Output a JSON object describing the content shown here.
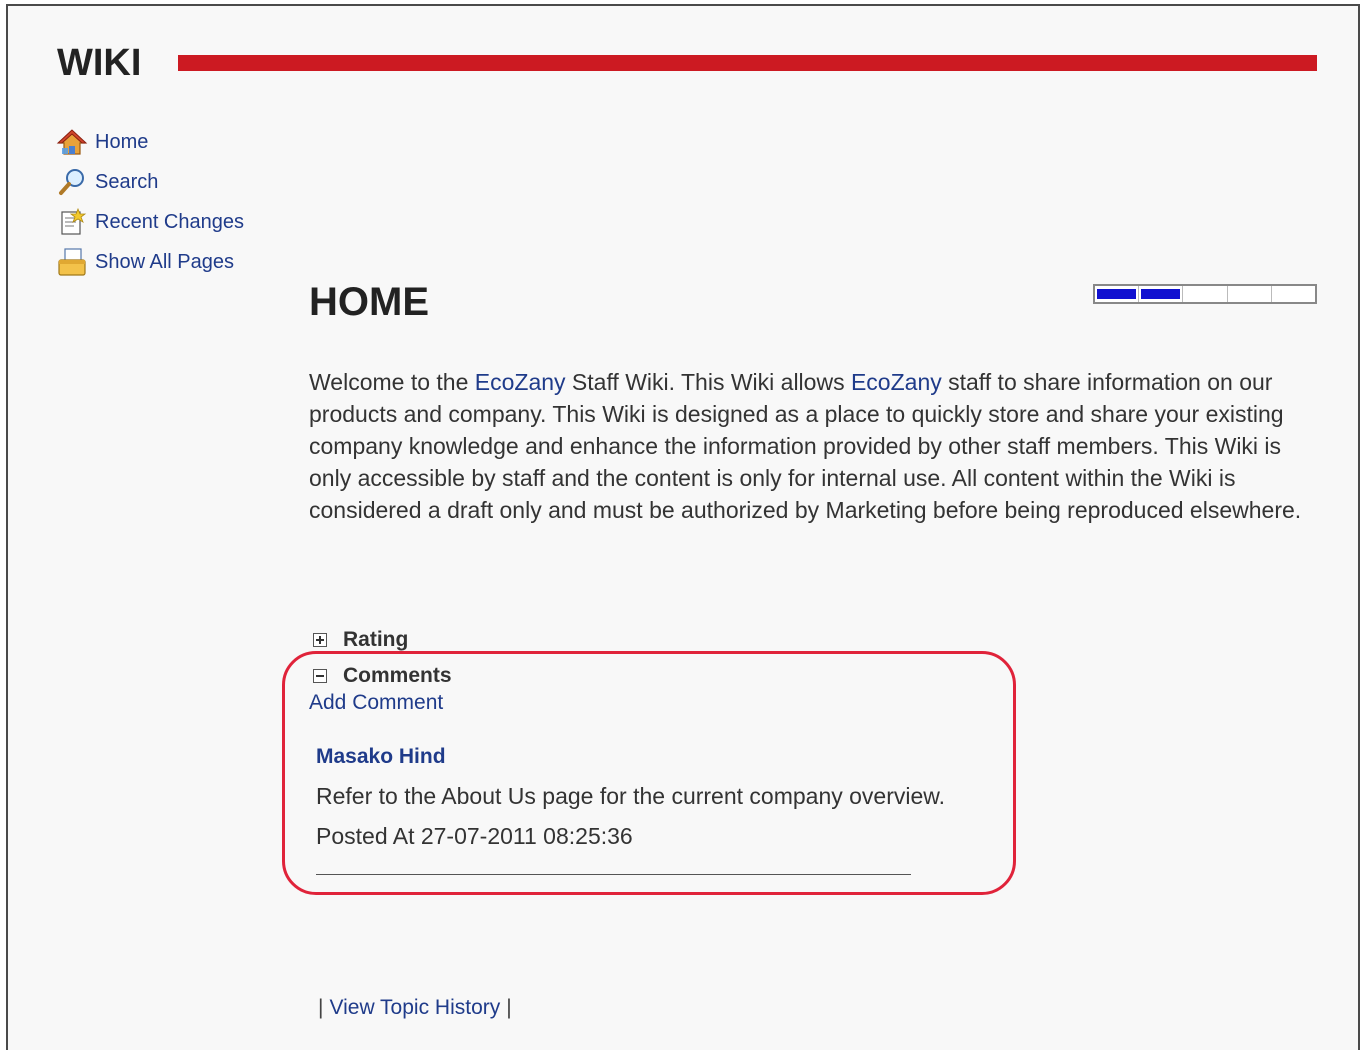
{
  "app": {
    "title": "WIKI"
  },
  "nav": {
    "items": [
      {
        "label": "Home",
        "icon": "home-icon"
      },
      {
        "label": "Search",
        "icon": "search-icon"
      },
      {
        "label": "Recent Changes",
        "icon": "recent-changes-icon"
      },
      {
        "label": "Show All Pages",
        "icon": "all-pages-icon"
      }
    ]
  },
  "page": {
    "heading": "HOME",
    "rating": {
      "filled_segments": 2,
      "total_segments": 5
    },
    "intro": {
      "p1": "Welcome to the ",
      "link1": "EcoZany",
      "p2": " Staff Wiki. This Wiki allows ",
      "link2": "EcoZany",
      "p3": " staff to share information on our products and company. This Wiki is designed as a place to quickly store and share your existing company knowledge and enhance the information provided by other staff members. This Wiki is only accessible by staff and the content is only for internal use. All content within the Wiki is considered a draft only and must be authorized by Marketing before being reproduced elsewhere."
    }
  },
  "sections": {
    "rating_label": "Rating",
    "comments_label": "Comments",
    "add_comment": "Add Comment"
  },
  "comment": {
    "author": "Masako Hind",
    "text": "Refer to the About Us page for the current company overview.",
    "posted": "Posted At 27-07-2011 08:25:36"
  },
  "footer": {
    "separator": "|",
    "view_history": "View Topic History"
  },
  "colors": {
    "accent_red": "#cc1a22",
    "link_blue": "#1f3b8a",
    "highlight_red": "#e0233a",
    "rating_fill": "#1010d0"
  }
}
